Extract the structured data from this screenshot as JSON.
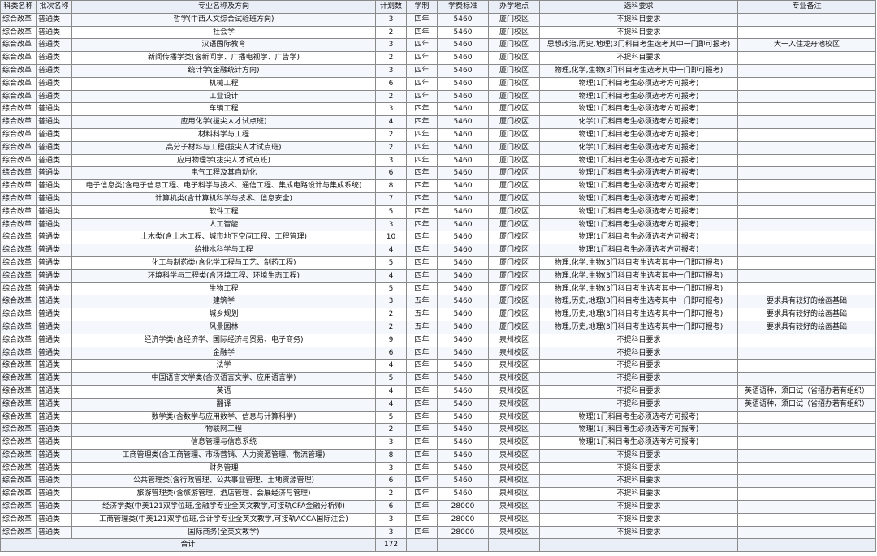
{
  "headers": [
    "科类名称",
    "批次名称",
    "专业名称及方向",
    "计划数",
    "学制",
    "学费标准",
    "办学地点",
    "选科要求",
    "专业备注"
  ],
  "rows": [
    [
      "综合改革",
      "普通类",
      "哲学(中西人文综合试验班方向)",
      "3",
      "四年",
      "5460",
      "厦门校区",
      "不提科目要求",
      ""
    ],
    [
      "综合改革",
      "普通类",
      "社会学",
      "2",
      "四年",
      "5460",
      "厦门校区",
      "不提科目要求",
      ""
    ],
    [
      "综合改革",
      "普通类",
      "汉语国际教育",
      "3",
      "四年",
      "5460",
      "厦门校区",
      "思想政治,历史,地理(3门科目考生选考其中一门即可报考)",
      "大一入住龙舟池校区"
    ],
    [
      "综合改革",
      "普通类",
      "新闻传播学类(含新闻学、广播电视学、广告学)",
      "2",
      "四年",
      "5460",
      "厦门校区",
      "不提科目要求",
      ""
    ],
    [
      "综合改革",
      "普通类",
      "统计学(金融统计方向)",
      "3",
      "四年",
      "5460",
      "厦门校区",
      "物理,化学,生物(3门科目考生选考其中一门即可报考)",
      ""
    ],
    [
      "综合改革",
      "普通类",
      "机械工程",
      "6",
      "四年",
      "5460",
      "厦门校区",
      "物理(1门科目考生必须选考方可报考)",
      ""
    ],
    [
      "综合改革",
      "普通类",
      "工业设计",
      "2",
      "四年",
      "5460",
      "厦门校区",
      "物理(1门科目考生必须选考方可报考)",
      ""
    ],
    [
      "综合改革",
      "普通类",
      "车辆工程",
      "3",
      "四年",
      "5460",
      "厦门校区",
      "物理(1门科目考生必须选考方可报考)",
      ""
    ],
    [
      "综合改革",
      "普通类",
      "应用化学(拔尖人才试点班)",
      "4",
      "四年",
      "5460",
      "厦门校区",
      "化学(1门科目考生必须选考方可报考)",
      ""
    ],
    [
      "综合改革",
      "普通类",
      "材料科学与工程",
      "2",
      "四年",
      "5460",
      "厦门校区",
      "物理(1门科目考生必须选考方可报考)",
      ""
    ],
    [
      "综合改革",
      "普通类",
      "高分子材料与工程(拔尖人才试点班)",
      "2",
      "四年",
      "5460",
      "厦门校区",
      "化学(1门科目考生必须选考方可报考)",
      ""
    ],
    [
      "综合改革",
      "普通类",
      "应用物理学(拔尖人才试点班)",
      "3",
      "四年",
      "5460",
      "厦门校区",
      "物理(1门科目考生必须选考方可报考)",
      ""
    ],
    [
      "综合改革",
      "普通类",
      "电气工程及其自动化",
      "6",
      "四年",
      "5460",
      "厦门校区",
      "物理(1门科目考生必须选考方可报考)",
      ""
    ],
    [
      "综合改革",
      "普通类",
      "电子信息类(含电子信息工程、电子科学与技术、通信工程、集成电路设计与集成系统)",
      "8",
      "四年",
      "5460",
      "厦门校区",
      "物理(1门科目考生必须选考方可报考)",
      ""
    ],
    [
      "综合改革",
      "普通类",
      "计算机类(含计算机科学与技术、信息安全)",
      "7",
      "四年",
      "5460",
      "厦门校区",
      "物理(1门科目考生必须选考方可报考)",
      ""
    ],
    [
      "综合改革",
      "普通类",
      "软件工程",
      "5",
      "四年",
      "5460",
      "厦门校区",
      "物理(1门科目考生必须选考方可报考)",
      ""
    ],
    [
      "综合改革",
      "普通类",
      "人工智能",
      "3",
      "四年",
      "5460",
      "厦门校区",
      "物理(1门科目考生必须选考方可报考)",
      ""
    ],
    [
      "综合改革",
      "普通类",
      "土木类(含土木工程、城市地下空间工程、工程管理)",
      "10",
      "四年",
      "5460",
      "厦门校区",
      "物理(1门科目考生必须选考方可报考)",
      ""
    ],
    [
      "综合改革",
      "普通类",
      "给排水科学与工程",
      "4",
      "四年",
      "5460",
      "厦门校区",
      "物理(1门科目考生必须选考方可报考)",
      ""
    ],
    [
      "综合改革",
      "普通类",
      "化工与制药类(含化学工程与工艺、制药工程)",
      "5",
      "四年",
      "5460",
      "厦门校区",
      "物理,化学,生物(3门科目考生选考其中一门即可报考)",
      ""
    ],
    [
      "综合改革",
      "普通类",
      "环境科学与工程类(含环境工程、环境生态工程)",
      "4",
      "四年",
      "5460",
      "厦门校区",
      "物理,化学,生物(3门科目考生选考其中一门即可报考)",
      ""
    ],
    [
      "综合改革",
      "普通类",
      "生物工程",
      "5",
      "四年",
      "5460",
      "厦门校区",
      "物理,化学,生物(3门科目考生选考其中一门即可报考)",
      ""
    ],
    [
      "综合改革",
      "普通类",
      "建筑学",
      "3",
      "五年",
      "5460",
      "厦门校区",
      "物理,历史,地理(3门科目考生选考其中一门即可报考)",
      "要求具有较好的绘画基础"
    ],
    [
      "综合改革",
      "普通类",
      "城乡规划",
      "2",
      "五年",
      "5460",
      "厦门校区",
      "物理,历史,地理(3门科目考生选考其中一门即可报考)",
      "要求具有较好的绘画基础"
    ],
    [
      "综合改革",
      "普通类",
      "风景园林",
      "2",
      "五年",
      "5460",
      "厦门校区",
      "物理,历史,地理(3门科目考生选考其中一门即可报考)",
      "要求具有较好的绘画基础"
    ],
    [
      "综合改革",
      "普通类",
      "经济学类(含经济学、国际经济与贸易、电子商务)",
      "9",
      "四年",
      "5460",
      "泉州校区",
      "不提科目要求",
      ""
    ],
    [
      "综合改革",
      "普通类",
      "金融学",
      "6",
      "四年",
      "5460",
      "泉州校区",
      "不提科目要求",
      ""
    ],
    [
      "综合改革",
      "普通类",
      "法学",
      "4",
      "四年",
      "5460",
      "泉州校区",
      "不提科目要求",
      ""
    ],
    [
      "综合改革",
      "普通类",
      "中国语言文学类(含汉语言文学、应用语言学)",
      "5",
      "四年",
      "5460",
      "泉州校区",
      "不提科目要求",
      ""
    ],
    [
      "综合改革",
      "普通类",
      "英语",
      "4",
      "四年",
      "5460",
      "泉州校区",
      "不提科目要求",
      "英语语种，须口试（省招办若有组织）"
    ],
    [
      "综合改革",
      "普通类",
      "翻译",
      "4",
      "四年",
      "5460",
      "泉州校区",
      "不提科目要求",
      "英语语种，须口试（省招办若有组织）"
    ],
    [
      "综合改革",
      "普通类",
      "数学类(含数学与应用数学、信息与计算科学)",
      "5",
      "四年",
      "5460",
      "泉州校区",
      "物理(1门科目考生必须选考方可报考)",
      ""
    ],
    [
      "综合改革",
      "普通类",
      "物联网工程",
      "2",
      "四年",
      "5460",
      "泉州校区",
      "物理(1门科目考生必须选考方可报考)",
      ""
    ],
    [
      "综合改革",
      "普通类",
      "信息管理与信息系统",
      "3",
      "四年",
      "5460",
      "泉州校区",
      "物理(1门科目考生必须选考方可报考)",
      ""
    ],
    [
      "综合改革",
      "普通类",
      "工商管理类(含工商管理、市场营销、人力资源管理、物流管理)",
      "8",
      "四年",
      "5460",
      "泉州校区",
      "不提科目要求",
      ""
    ],
    [
      "综合改革",
      "普通类",
      "财务管理",
      "3",
      "四年",
      "5460",
      "泉州校区",
      "不提科目要求",
      ""
    ],
    [
      "综合改革",
      "普通类",
      "公共管理类(含行政管理、公共事业管理、土地资源管理)",
      "6",
      "四年",
      "5460",
      "泉州校区",
      "不提科目要求",
      ""
    ],
    [
      "综合改革",
      "普通类",
      "旅游管理类(含旅游管理、酒店管理、会展经济与管理)",
      "2",
      "四年",
      "5460",
      "泉州校区",
      "不提科目要求",
      ""
    ],
    [
      "综合改革",
      "普通类",
      "经济学类(中美121双学位班,金融学专业全英文教学,可接轨CFA金融分析师)",
      "6",
      "四年",
      "28000",
      "泉州校区",
      "不提科目要求",
      ""
    ],
    [
      "综合改革",
      "普通类",
      "工商管理类(中美121双学位班,会计学专业全英文教学,可接轨ACCA国际注会)",
      "3",
      "四年",
      "28000",
      "泉州校区",
      "不提科目要求",
      ""
    ],
    [
      "综合改革",
      "普通类",
      "国际商务(全英文教学)",
      "3",
      "四年",
      "28000",
      "泉州校区",
      "不提科目要求",
      ""
    ]
  ],
  "footer": {
    "label": "合计",
    "total": "172"
  }
}
